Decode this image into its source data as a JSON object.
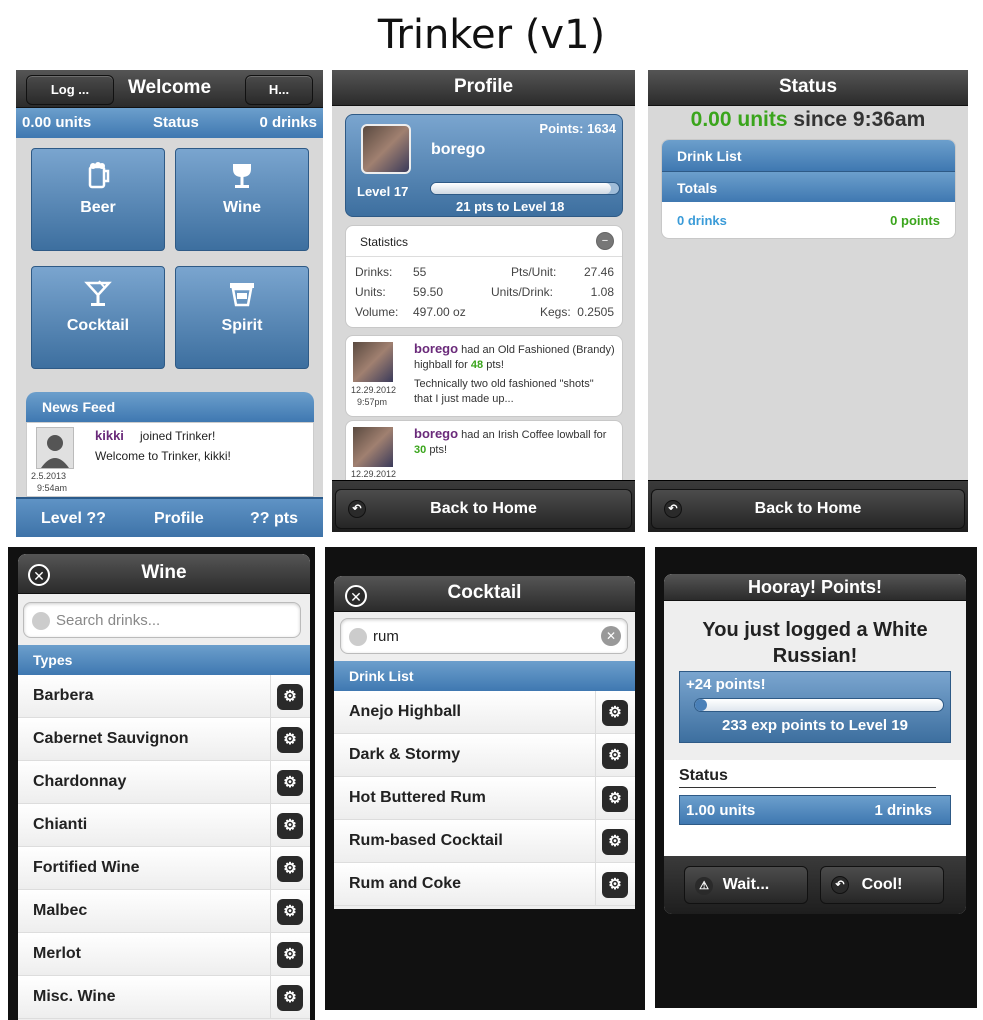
{
  "page": {
    "title": "Trinker (v1)"
  },
  "welcome": {
    "header_title": "Welcome",
    "left_btn": "Log ...",
    "right_btn": "H...",
    "status_bar": {
      "units": "0.00 units",
      "label": "Status",
      "drinks": "0 drinks"
    },
    "tiles": [
      {
        "label": "Beer",
        "icon": "beer-mug-icon"
      },
      {
        "label": "Wine",
        "icon": "wine-glass-icon"
      },
      {
        "label": "Cocktail",
        "icon": "cocktail-glass-icon"
      },
      {
        "label": "Spirit",
        "icon": "spirit-glass-icon"
      }
    ],
    "news_feed": {
      "title": "News Feed",
      "user": "kikki",
      "action": "joined Trinker!",
      "message": "Welcome to Trinker, kikki!",
      "date": "2.5.2013",
      "time": "9:54am"
    },
    "footer": {
      "level": "Level ??",
      "profile": "Profile",
      "pts": "?? pts"
    }
  },
  "profile": {
    "header_title": "Profile",
    "user": "borego",
    "points": "Points: 1634",
    "level": "Level 17",
    "progress_text": "21 pts to Level 18",
    "progress_fraction": 0.96,
    "statistics": {
      "title": "Statistics",
      "drinks_label": "Drinks:",
      "drinks": "55",
      "pts_unit_label": "Pts/Unit:",
      "pts_unit": "27.46",
      "units_label": "Units:",
      "units": "59.50",
      "units_drink_label": "Units/Drink:",
      "units_drink": "1.08",
      "volume_label": "Volume:",
      "volume": "497.00 oz",
      "kegs_label": "Kegs:",
      "kegs": "0.2505"
    },
    "feed": [
      {
        "user": "borego",
        "text_a": "had an Old Fashioned (Brandy) highball for",
        "pts": "48",
        "text_b": "pts!",
        "comment": "Technically two old fashioned \"shots\" that I just made up...",
        "date": "12.29.2012",
        "time": "9:57pm"
      },
      {
        "user": "borego",
        "text_a": "had an Irish Coffee lowball for",
        "pts": "30",
        "text_b": "pts!",
        "date": "12.29.2012"
      }
    ],
    "back_btn": "Back to Home"
  },
  "status": {
    "header_title": "Status",
    "units": "0.00 units",
    "since": "since 9:36am",
    "drink_list": "Drink List",
    "totals": "Totals",
    "drinks": "0 drinks",
    "points": "0 points",
    "back_btn": "Back to Home"
  },
  "wine": {
    "header_title": "Wine",
    "search_placeholder": "Search drinks...",
    "section": "Types",
    "items": [
      "Barbera",
      "Cabernet Sauvignon",
      "Chardonnay",
      "Chianti",
      "Fortified Wine",
      "Malbec",
      "Merlot",
      "Misc. Wine"
    ]
  },
  "cocktail": {
    "header_title": "Cocktail",
    "search_value": "rum",
    "section": "Drink List",
    "items": [
      "Anejo Highball",
      "Dark & Stormy",
      "Hot Buttered Rum",
      "Rum-based Cocktail",
      "Rum and Coke"
    ]
  },
  "hooray": {
    "header_title": "Hooray! Points!",
    "message": "You just logged a White Russian!",
    "points_gain": "+24 points!",
    "progress_text": "233 exp points to Level 19",
    "progress_fraction": 0.02,
    "status_label": "Status",
    "units": "1.00 units",
    "drinks": "1 drinks",
    "wait_btn": "Wait...",
    "cool_btn": "Cool!"
  },
  "colors": {
    "accent_blue": "#4a80b8",
    "green": "#3aa51c",
    "purple": "#6a2a7a",
    "link_blue": "#3a9bd8"
  }
}
